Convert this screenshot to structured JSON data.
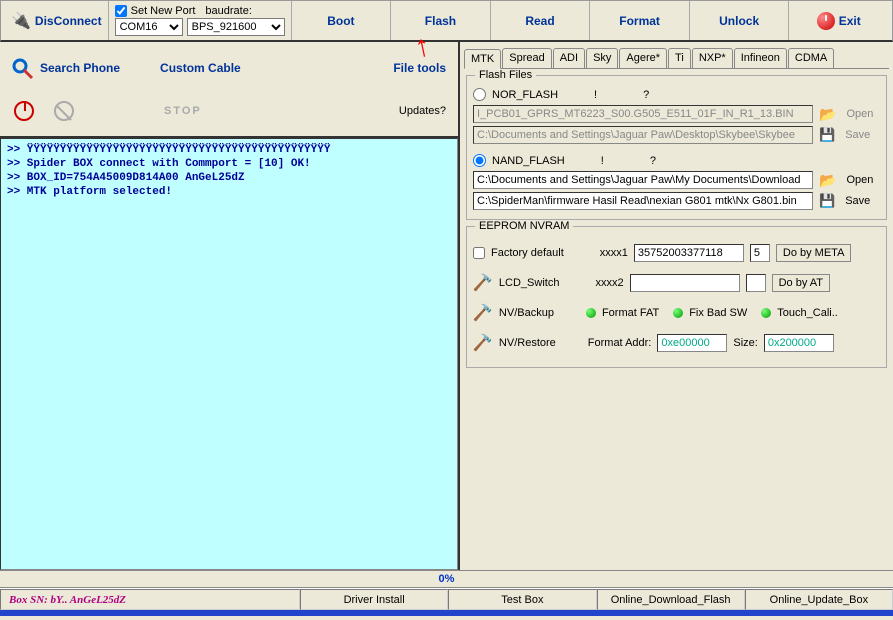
{
  "toolbar": {
    "connect_label": "DisConnect",
    "set_port_label": "Set New Port",
    "set_port_checked": true,
    "baudrate_label": "baudrate:",
    "com_value": "COM16",
    "baud_value": "BPS_921600",
    "buttons": {
      "boot": "Boot",
      "flash": "Flash",
      "read": "Read",
      "format": "Format",
      "unlock": "Unlock",
      "exit": "Exit"
    }
  },
  "left_tools": {
    "search_phone": "Search Phone",
    "custom_cable": "Custom Cable",
    "file_tools": "File tools",
    "stop_label": "STOP",
    "updates_label": "Updates?"
  },
  "log_lines": [
    ">> ŸŸŸŸŸŸŸŸŸŸŸŸŸŸŸŸŸŸŸŸŸŸŸŸŸŸŸŸŸŸŸŸŸŸŸŸŸŸŸŸŸŸŸŸŸŸ",
    ">> Spider BOX connect with Commport = [10] OK!",
    ">> BOX_ID=754A45009D814A00 AnGeL25dZ",
    ">> MTK platform selected!"
  ],
  "tabs": [
    "MTK",
    "Spread",
    "ADI",
    "Sky",
    "Agere*",
    "Ti",
    "NXP*",
    "Infineon",
    "CDMA"
  ],
  "active_tab_index": 0,
  "flash_files": {
    "title": "Flash Files",
    "nor_label": "NOR_FLASH",
    "nand_label": "NAND_FLASH",
    "exclaim": "!",
    "question": "?",
    "nor_path1": "I_PCB01_GPRS_MT6223_S00.G505_E511_01F_IN_R1_13.BIN",
    "nor_path2": "C:\\Documents and Settings\\Jaguar Paw\\Desktop\\Skybee\\Skybee",
    "nand_path1": "C:\\Documents and Settings\\Jaguar Paw\\My Documents\\Download",
    "nand_path2": "C:\\SpiderMan\\firmware Hasil Read\\nexian G801 mtk\\Nx G801.bin",
    "open_label": "Open",
    "save_label": "Save"
  },
  "eeprom": {
    "title": "EEPROM NVRAM",
    "factory_default": "Factory default",
    "xxxx1": "xxxx1",
    "xxxx1_value": "35752003377118",
    "xxxx1_extra": "5",
    "do_by_meta": "Do by META",
    "lcd_switch": "LCD_Switch",
    "xxxx2": "xxxx2",
    "do_by_at": "Do by AT",
    "nv_backup": "NV/Backup",
    "format_fat": "Format FAT",
    "fix_bad_sw": "Fix Bad SW",
    "touch_cali": "Touch_Cali..",
    "nv_restore": "NV/Restore",
    "format_addr_label": "Format Addr:",
    "format_addr_value": "0xe00000",
    "size_label": "Size:",
    "size_value": "0x200000"
  },
  "progress": "0%",
  "status": {
    "sn": "Box SN: bY.. AnGeL25dZ",
    "driver_install": "Driver Install",
    "test_box": "Test Box",
    "online_download": "Online_Download_Flash",
    "online_update": "Online_Update_Box"
  }
}
